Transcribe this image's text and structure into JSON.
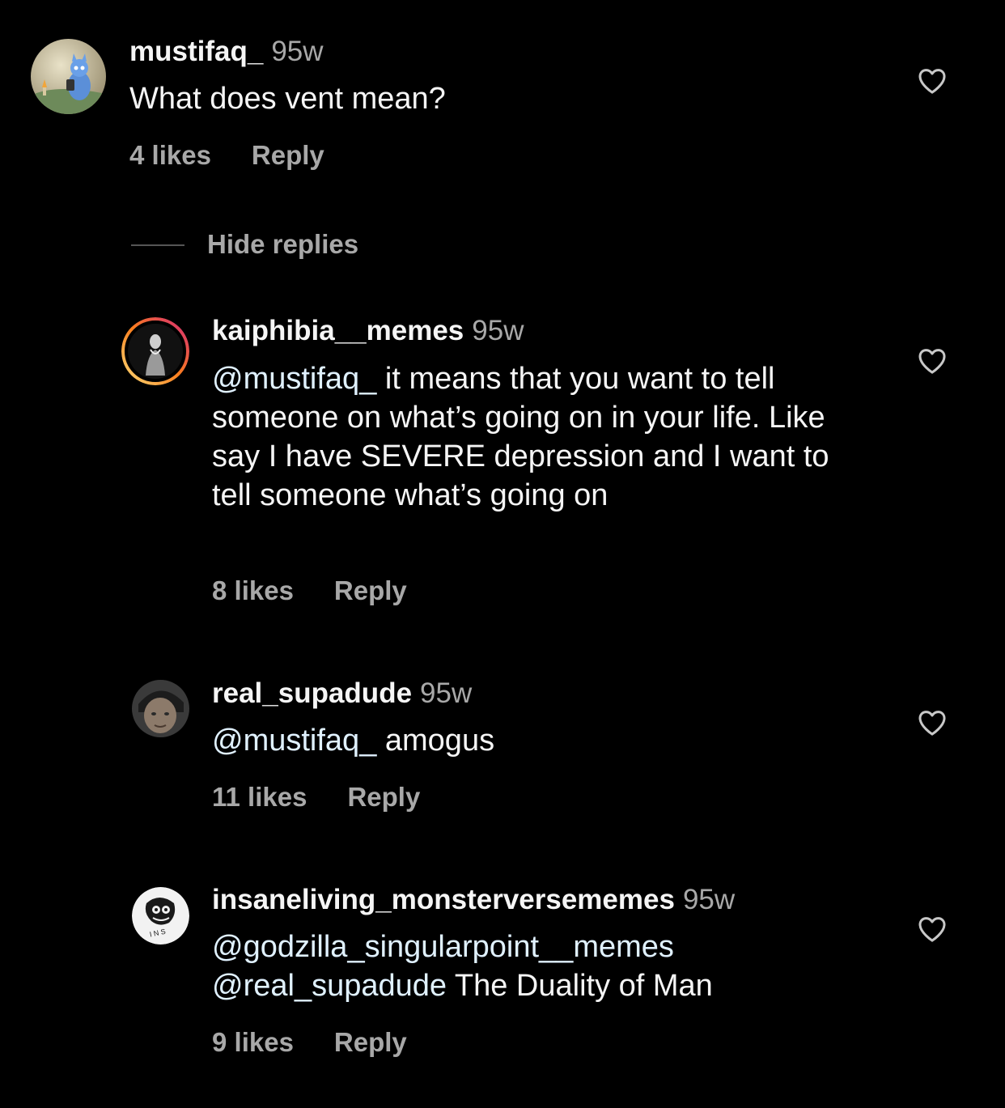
{
  "colors": {
    "background": "#000000",
    "primary_text": "#f5f5f5",
    "secondary_text": "#a8a8a8",
    "mention": "#e0f1ff",
    "story_ring_start": "#feda75",
    "story_ring_end": "#d62976"
  },
  "comment": {
    "username": "mustifaq_",
    "time": "95w",
    "text": "What does vent mean?",
    "likes": "4 likes",
    "reply_label": "Reply",
    "avatar_icon": "cartoon-cat-avatar",
    "like_icon": "heart-outline-icon"
  },
  "hide_replies_label": "Hide replies",
  "replies": [
    {
      "username": "kaiphibia__memes",
      "time": "95w",
      "mention": "@mustifaq_",
      "text": " it means that you want to tell someone on what’s going on in your life. Like say I have SEVERE depression and I want to tell someone what’s going on",
      "likes": "8 likes",
      "reply_label": "Reply",
      "avatar_icon": "statue-avatar-with-story-ring"
    },
    {
      "username": "real_supadude",
      "time": "95w",
      "mention": "@mustifaq_",
      "text": " amogus",
      "likes": "11 likes",
      "reply_label": "Reply",
      "avatar_icon": "face-photo-avatar"
    },
    {
      "username": "insaneliving_monsterversememes",
      "time": "95w",
      "mention": "@godzilla_singularpoint__memes",
      "mention2": "@real_supadude",
      "text": " The Duality of Man",
      "likes": "9 likes",
      "reply_label": "Reply",
      "avatar_icon": "ins-logo-avatar"
    }
  ]
}
